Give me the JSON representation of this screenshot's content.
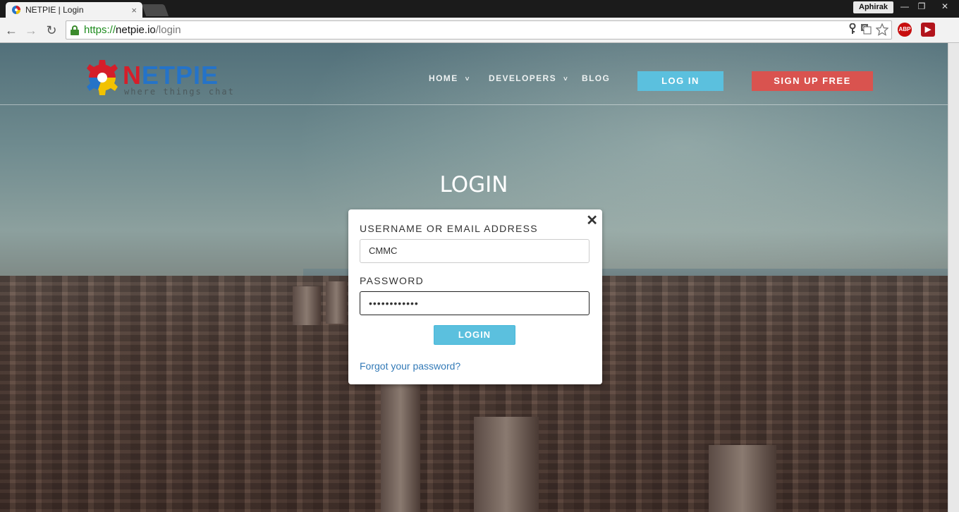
{
  "browser": {
    "tab_title": "NETPIE | Login",
    "tab_close": "×",
    "profile_name": "Aphirak",
    "win_min": "—",
    "win_max": "❐",
    "win_close": "✕",
    "url_scheme": "https://",
    "url_host": "netpie.io",
    "url_path": "/login",
    "ext_abp": "ABP",
    "ext_rp": "▶"
  },
  "site": {
    "logo_letter_n": "N",
    "logo_rest": "ETPIE",
    "logo_tagline": "where things chat",
    "nav": {
      "home": "HOME",
      "developers": "DEVELOPERS",
      "blog": "BLOG",
      "chevron": "˅"
    },
    "login_button": "LOG IN",
    "signup_button": "SIGN UP FREE",
    "page_heading": "LOGIN"
  },
  "modal": {
    "close": "✕",
    "username_label": "USERNAME OR EMAIL ADDRESS",
    "username_value": "CMMC",
    "password_label": "PASSWORD",
    "password_value": "••••••••••••",
    "submit_label": "LOGIN",
    "forgot_link": "Forgot your password?"
  },
  "colors": {
    "accent_blue": "#5bc0de",
    "signup_red": "#d9534f",
    "link_blue": "#337ab7",
    "logo_red": "#d51e2a",
    "logo_blue": "#2573c8"
  }
}
